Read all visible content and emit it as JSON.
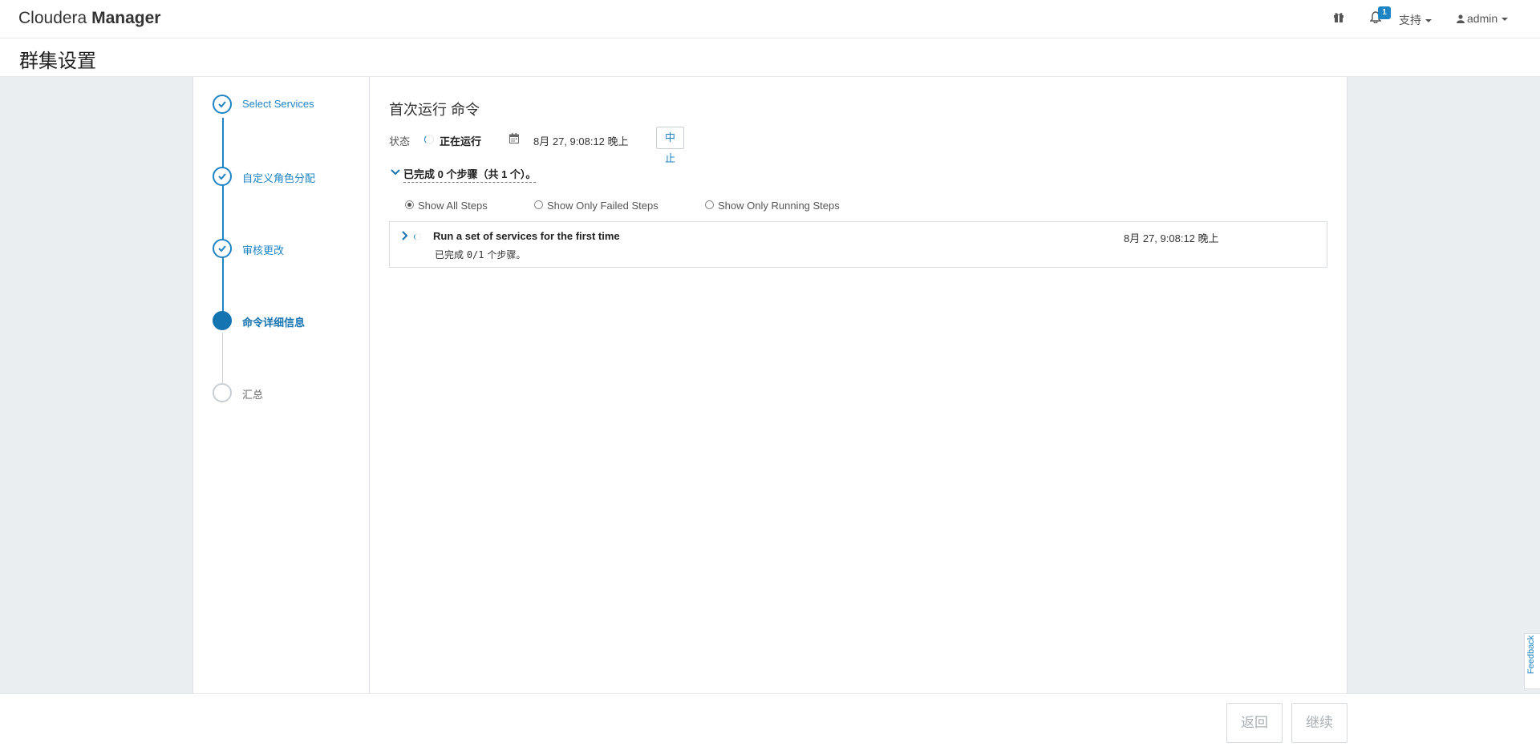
{
  "app": {
    "brand_light": "Cloudera",
    "brand_bold": "Manager"
  },
  "nav": {
    "gift_icon": "gift-icon",
    "bell_icon": "bell-icon",
    "notification_count": "1",
    "support_label": "支持",
    "user_label": "admin"
  },
  "page": {
    "title": "群集设置"
  },
  "wizard": {
    "steps": [
      {
        "label": "Select Services",
        "state": "done"
      },
      {
        "label": "自定义角色分配",
        "state": "done"
      },
      {
        "label": "审核更改",
        "state": "done"
      },
      {
        "label": "命令详细信息",
        "state": "current"
      },
      {
        "label": "汇总",
        "state": "pending"
      }
    ]
  },
  "command": {
    "title": "首次运行 命令",
    "status_label": "状态",
    "status_value": "正在运行",
    "start_time": "8月 27, 9:08:12 晚上",
    "abort_label": "中止",
    "summary": "已完成 0 个步骤（共 1 个）。",
    "filters": [
      {
        "label": "Show All Steps",
        "checked": true
      },
      {
        "label": "Show Only Failed Steps",
        "checked": false
      },
      {
        "label": "Show Only Running Steps",
        "checked": false
      }
    ],
    "steps": [
      {
        "title": "Run a set of services for the first time",
        "time": "8月 27, 9:08:12 晚上",
        "sub_prefix": "已完成 ",
        "sub_progress": "0/1",
        "sub_suffix": " 个步骤。"
      }
    ]
  },
  "footer": {
    "back_label": "返回",
    "continue_label": "继续"
  },
  "feedback": {
    "label": "Feedback"
  },
  "colors": {
    "accent": "#1f84c3",
    "current_step": "#1473b1",
    "page_bg": "#ebeef1"
  }
}
